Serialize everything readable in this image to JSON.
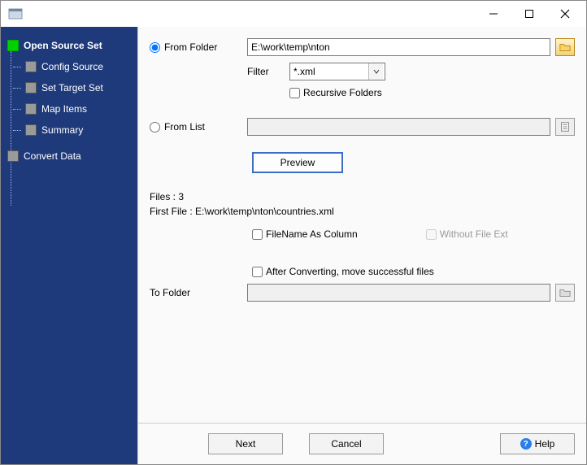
{
  "window": {
    "title": ""
  },
  "sidebar": {
    "items": [
      {
        "label": "Open Source Set",
        "active": true
      },
      {
        "label": "Config Source",
        "active": false
      },
      {
        "label": "Set Target Set",
        "active": false
      },
      {
        "label": "Map Items",
        "active": false
      },
      {
        "label": "Summary",
        "active": false
      },
      {
        "label": "Convert Data",
        "active": false
      }
    ]
  },
  "form": {
    "from_folder": {
      "label": "From Folder",
      "value": "E:\\work\\temp\\nton"
    },
    "filter": {
      "label": "Filter",
      "value": "*.xml"
    },
    "recursive": {
      "label": "Recursive Folders",
      "checked": false
    },
    "from_list": {
      "label": "From List",
      "value": ""
    },
    "preview_button": "Preview",
    "files_count_label": "Files : 3",
    "first_file_label": "First File : E:\\work\\temp\\nton\\countries.xml",
    "filename_as_column": {
      "label": "FileName As Column",
      "checked": false
    },
    "without_ext": {
      "label": "Without File Ext",
      "checked": false,
      "disabled": true
    },
    "move_after": {
      "label": "After Converting, move successful files",
      "checked": false
    },
    "to_folder": {
      "label": "To Folder",
      "value": ""
    }
  },
  "buttons": {
    "next": "Next",
    "cancel": "Cancel",
    "help": "Help"
  }
}
